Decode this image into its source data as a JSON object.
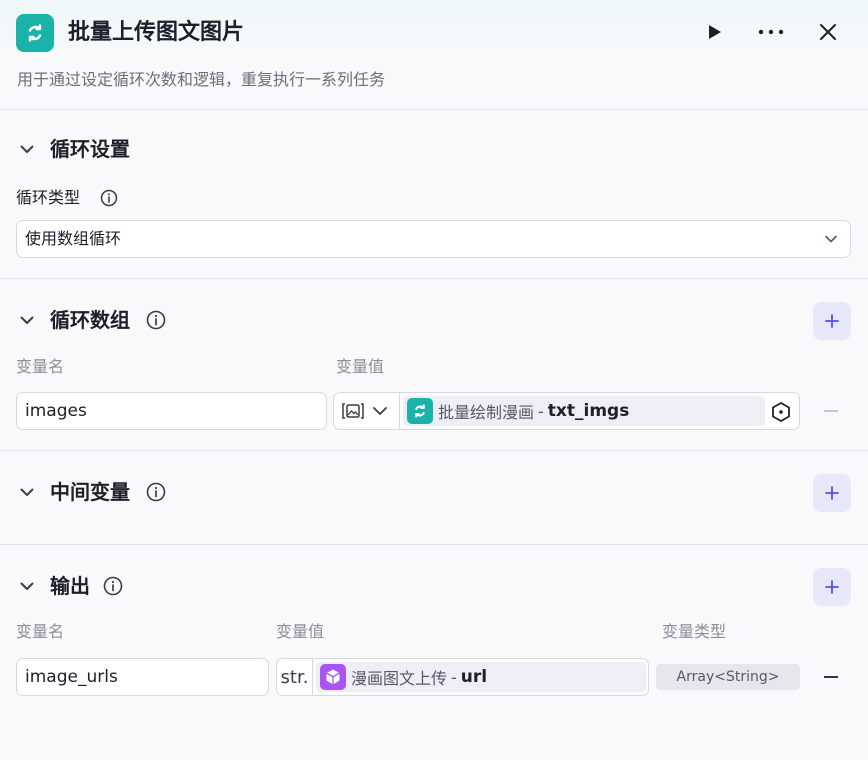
{
  "header": {
    "title": "批量上传图文图片",
    "description": "用于通过设定循环次数和逻辑，重复执行一系列任务",
    "icon": "loop-icon",
    "icon_color": "#1bb3a9"
  },
  "loop_settings": {
    "section_title": "循环设置",
    "type_label": "循环类型",
    "type_value": "使用数组循环"
  },
  "loop_array": {
    "section_title": "循环数组",
    "col_name": "变量名",
    "col_value": "变量值",
    "rows": [
      {
        "name": "images",
        "type_icon": "image-type-icon",
        "ref_node": "批量绘制漫画",
        "ref_sep": "-",
        "ref_var": "txt_imgs"
      }
    ]
  },
  "intermediate": {
    "section_title": "中间变量"
  },
  "output": {
    "section_title": "输出",
    "col_name": "变量名",
    "col_value": "变量值",
    "col_type": "变量类型",
    "rows": [
      {
        "name": "image_urls",
        "type_prefix": "str.",
        "ref_node": "漫画图文上传",
        "ref_sep": "-",
        "ref_var": "url",
        "var_type": "Array<String>",
        "ref_icon_color": "#a855f7"
      }
    ]
  },
  "colors": {
    "accent": "#4d53e8",
    "plus_bg": "#e8e8fb",
    "loop_teal": "#1bb3a9",
    "plugin_purple": "#a855f7"
  }
}
